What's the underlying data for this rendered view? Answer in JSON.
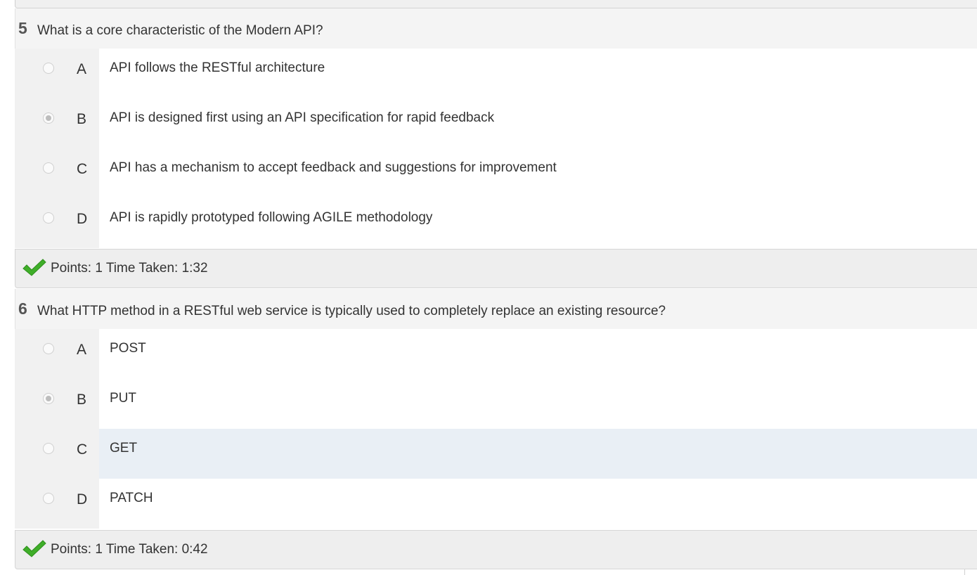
{
  "questions": [
    {
      "number": "5",
      "text": "What is a core characteristic of the Modern API?",
      "selected": "B",
      "answers": [
        {
          "letter": "A",
          "text": "API follows the RESTful architecture"
        },
        {
          "letter": "B",
          "text": "API is designed first using an API specification for rapid feedback"
        },
        {
          "letter": "C",
          "text": "API has a mechanism to accept feedback and suggestions for improvement"
        },
        {
          "letter": "D",
          "text": "API is rapidly prototyped following AGILE methodology"
        }
      ],
      "result": "Points: 1 Time Taken: 1:32"
    },
    {
      "number": "6",
      "text": "What HTTP method in a RESTful web service is typically used to completely replace an existing resource?",
      "selected": "B",
      "answers": [
        {
          "letter": "A",
          "text": "POST"
        },
        {
          "letter": "B",
          "text": "PUT"
        },
        {
          "letter": "C",
          "text": "GET"
        },
        {
          "letter": "D",
          "text": "PATCH"
        }
      ],
      "result": "Points: 1 Time Taken: 0:42"
    }
  ],
  "colors": {
    "check_green": "#3fae29",
    "highlight_row": "#e9eff5",
    "gutter": "#f1f1f1"
  },
  "icons": {
    "result": "checkmark-icon"
  }
}
